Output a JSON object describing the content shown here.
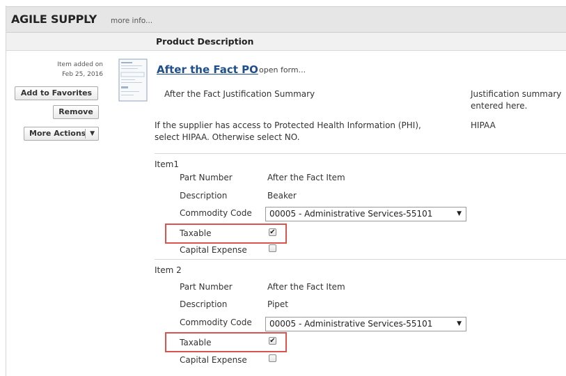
{
  "supplier": {
    "name": "AGILE SUPPLY",
    "more_info": "more info..."
  },
  "columns": {
    "product_description": "Product Description"
  },
  "item_meta": {
    "added_label": "Item added on",
    "added_date": "Feb 25, 2016"
  },
  "actions": {
    "add_to_favorites": "Add to Favorites",
    "remove": "Remove",
    "more_actions": "More Actions",
    "caret": "▼"
  },
  "form": {
    "icon": "document-form-icon",
    "title": "After the Fact PO",
    "open_form": "open form...",
    "justification_label": "After the Fact Justification Summary",
    "justification_value_line1": "Justification summary",
    "justification_value_line2": "entered here.",
    "phi_question_line1": "If the supplier has access to Protected Health Information (PHI),",
    "phi_question_line2": "select HIPAA. Otherwise select NO.",
    "phi_value": "HIPAA"
  },
  "labels": {
    "part_number": "Part Number",
    "description": "Description",
    "commodity_code": "Commodity Code",
    "taxable": "Taxable",
    "capital_expense": "Capital Expense"
  },
  "items": [
    {
      "heading": "Item1",
      "part_number": "After the Fact Item",
      "description": "Beaker",
      "commodity_code": "00005 - Administrative Services-55101",
      "taxable": true,
      "capital_expense": false
    },
    {
      "heading": "Item 2",
      "part_number": "After the Fact Item",
      "description": "Pipet",
      "commodity_code": "00005 - Administrative Services-55101",
      "taxable": true,
      "capital_expense": false
    }
  ],
  "glyphs": {
    "select_arrow": "▼",
    "check": "✔"
  },
  "colors": {
    "link": "#1f4e8c",
    "highlight": "#d9534f",
    "header_bg": "#e6e6e6"
  }
}
